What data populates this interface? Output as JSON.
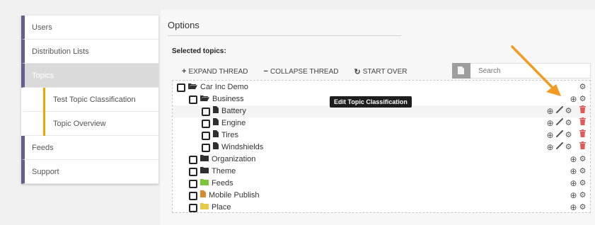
{
  "sidebar": {
    "items": [
      {
        "label": "Users"
      },
      {
        "label": "Distribution Lists"
      },
      {
        "label": "Topics"
      },
      {
        "label": "Test Topic Classification"
      },
      {
        "label": "Topic Overview"
      },
      {
        "label": "Feeds"
      },
      {
        "label": "Support"
      }
    ]
  },
  "main": {
    "title": "Options",
    "selected_label": "Selected topics:",
    "toolbar": {
      "expand": "EXPAND THREAD",
      "collapse": "COLLAPSE THREAD",
      "start_over": "START OVER"
    },
    "search": {
      "placeholder": "Search"
    },
    "tooltip": "Edit Topic Classification",
    "tree": [
      {
        "label": "Car Inc Demo",
        "level": 0,
        "icon": "folder-open-icon",
        "actions": [
          "gear"
        ]
      },
      {
        "label": "Business",
        "level": 1,
        "icon": "folder-open-icon",
        "actions": [
          "add",
          "gear"
        ]
      },
      {
        "label": "Battery",
        "level": 2,
        "icon": "file-icon",
        "actions": [
          "add",
          "wrench",
          "gear",
          "trash"
        ]
      },
      {
        "label": "Engine",
        "level": 2,
        "icon": "file-icon",
        "actions": [
          "add",
          "wrench",
          "gear",
          "trash"
        ]
      },
      {
        "label": "Tires",
        "level": 2,
        "icon": "file-icon",
        "actions": [
          "add",
          "wrench",
          "gear",
          "trash"
        ]
      },
      {
        "label": "Windshields",
        "level": 2,
        "icon": "file-icon",
        "actions": [
          "add",
          "wrench",
          "gear",
          "trash"
        ]
      },
      {
        "label": "Organization",
        "level": 1,
        "icon": "folder-icon",
        "actions": [
          "add",
          "gear"
        ]
      },
      {
        "label": "Theme",
        "level": 1,
        "icon": "folder-icon",
        "actions": [
          "add",
          "gear"
        ]
      },
      {
        "label": "Feeds",
        "level": 1,
        "icon": "folder-green-icon",
        "actions": [
          "add",
          "gear"
        ]
      },
      {
        "label": "Mobile Publish",
        "level": 1,
        "icon": "file-orange-icon",
        "actions": [
          "add",
          "gear"
        ]
      },
      {
        "label": "Place",
        "level": 1,
        "icon": "folder-yellow-icon",
        "actions": [
          "add",
          "gear"
        ]
      }
    ]
  },
  "colors": {
    "sidebar_accent": "#675e8e",
    "sub_accent": "#f0a400",
    "arrow": "#f39a21",
    "trash": "#e05a5a"
  }
}
